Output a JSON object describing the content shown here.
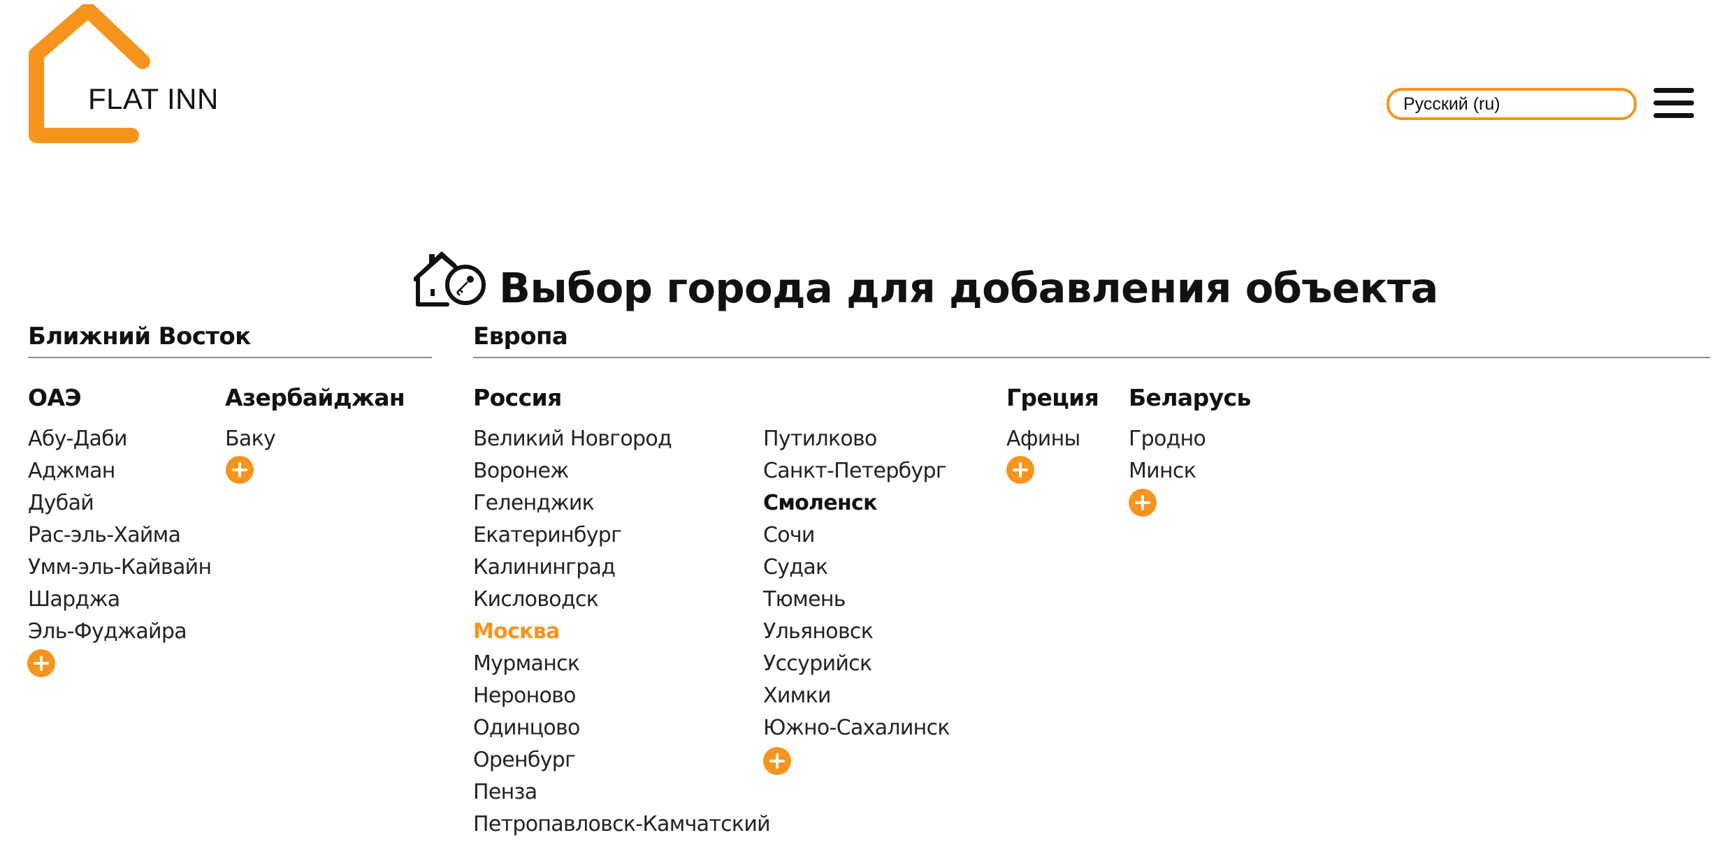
{
  "header": {
    "logo_text": "FLAT INN",
    "language": "Русский (ru)"
  },
  "page": {
    "title": "Выбор города для добавления объекта"
  },
  "colors": {
    "accent": "#F7941D",
    "text": "#111111",
    "rule": "#8c8c8c"
  },
  "icons": {
    "menu": "hamburger-menu-icon",
    "title": "house-key-icon",
    "add": "plus-circle-icon"
  },
  "regions": {
    "middle_east": {
      "name": "Ближний Восток",
      "uae": {
        "name": "ОАЭ",
        "cities": [
          "Абу-Даби",
          "Аджман",
          "Дубай",
          "Рас-эль-Хайма",
          "Умм-эль-Кайвайн",
          "Шарджа",
          "Эль-Фуджайра"
        ]
      },
      "azerbaijan": {
        "name": "Азербайджан",
        "cities": [
          "Баку"
        ]
      }
    },
    "europe": {
      "name": "Европа",
      "russia": {
        "name": "Россия",
        "cities_col1": [
          "Великий Новгород",
          "Воронеж",
          "Геленджик",
          "Екатеринбург",
          "Калининград",
          "Кисловодск",
          "Москва",
          "Мурманск",
          "Нероново",
          "Одинцово",
          "Оренбург",
          "Пенза",
          "Петропавловск-Камчатский"
        ],
        "cities_col2": [
          "Путилково",
          "Санкт-Петербург",
          "Смоленск",
          "Сочи",
          "Судак",
          "Тюмень",
          "Ульяновск",
          "Уссурийск",
          "Химки",
          "Южно-Сахалинск"
        ],
        "active_city": "Москва"
      },
      "greece": {
        "name": "Греция",
        "cities": [
          "Афины"
        ]
      },
      "belarus": {
        "name": "Беларусь",
        "cities": [
          "Гродно",
          "Минск"
        ]
      }
    }
  }
}
